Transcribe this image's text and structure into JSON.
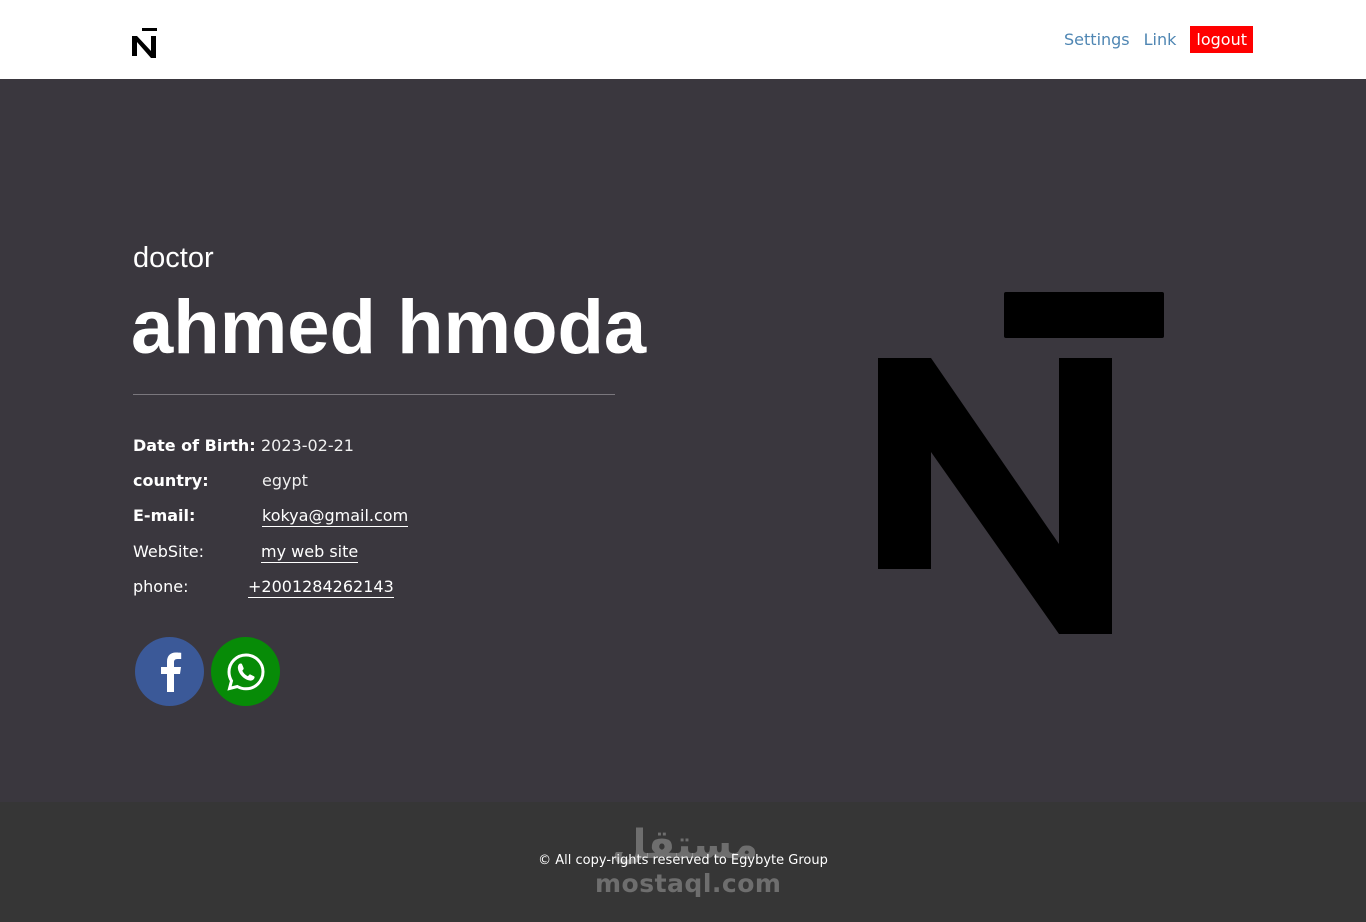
{
  "header": {
    "brand_icon": "n-bar-logo-icon",
    "nav": {
      "settings_label": "Settings",
      "link_label": "Link",
      "logout_label": "logout"
    }
  },
  "profile": {
    "title": "doctor",
    "name": "ahmed hmoda",
    "fields": {
      "dob": {
        "label": "Date of Birth:",
        "value": "2023-02-21"
      },
      "country": {
        "label": "country:",
        "value": "egypt"
      },
      "email": {
        "label": "E-mail:",
        "value": "kokya@gmail.com"
      },
      "website": {
        "label": "WebSite:",
        "value": "my web site"
      },
      "phone": {
        "label": "phone:",
        "value": "+2001284262143"
      }
    },
    "social": [
      {
        "icon": "facebook-icon",
        "color": "#3b5998"
      },
      {
        "icon": "whatsapp-icon",
        "color": "#078b07"
      }
    ]
  },
  "footer": {
    "copyright": "© All copy-rights reserved to Egybyte Group",
    "watermark_arabic": "مستقل",
    "watermark_latin": "mostaql.com"
  },
  "colors": {
    "header_bg": "#ffffff",
    "hero_bg": "#3a373e",
    "footer_bg": "#363636",
    "nav_link": "#4f86b3",
    "logout_bg": "#ff0000"
  }
}
